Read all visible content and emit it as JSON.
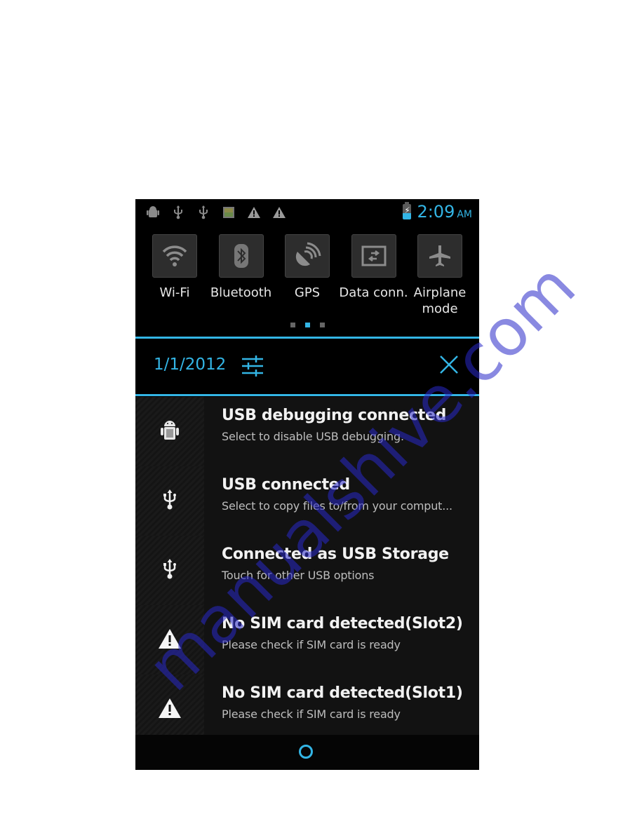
{
  "status_bar": {
    "left_icons": [
      "android-debug-icon",
      "usb-icon",
      "usb-icon",
      "gallery-icon",
      "warning-icon",
      "warning-icon"
    ],
    "battery_icon": "battery-charging-icon",
    "time": "2:09",
    "ampm": "AM"
  },
  "quick_settings": {
    "toggles": [
      {
        "label": "Wi-Fi",
        "icon": "wifi-icon"
      },
      {
        "label": "Bluetooth",
        "icon": "bluetooth-icon"
      },
      {
        "label": "GPS",
        "icon": "gps-icon"
      },
      {
        "label": "Data conn.",
        "icon": "data-connection-icon"
      },
      {
        "label_line1": "Airplane",
        "label_line2": "mode",
        "icon": "airplane-icon"
      }
    ],
    "pages": 3,
    "active_page": 2
  },
  "header": {
    "date": "1/1/2012",
    "settings_icon": "settings-sliders-icon",
    "close_icon": "close-icon"
  },
  "notifications": [
    {
      "title": "USB debugging connected",
      "subtitle": "Select to disable USB debugging.",
      "icon": "android-debug-icon"
    },
    {
      "title": "USB connected",
      "subtitle": "Select to copy files to/from your comput...",
      "icon": "usb-icon"
    },
    {
      "title": "Connected as USB Storage",
      "subtitle": "Touch for other USB options",
      "icon": "usb-icon"
    },
    {
      "title": "No SIM card detected(Slot2)",
      "subtitle": "Please check if SIM card is ready",
      "icon": "warning-icon"
    },
    {
      "title": "No SIM card detected(Slot1)",
      "subtitle": "Please check if SIM card is ready",
      "icon": "warning-icon"
    }
  ],
  "nav_bar": {
    "home_icon": "home-circle-icon"
  },
  "watermark": "manualshive.com",
  "colors": {
    "accent": "#33b5e5",
    "background": "#000000",
    "notification_bg": "#121212"
  }
}
